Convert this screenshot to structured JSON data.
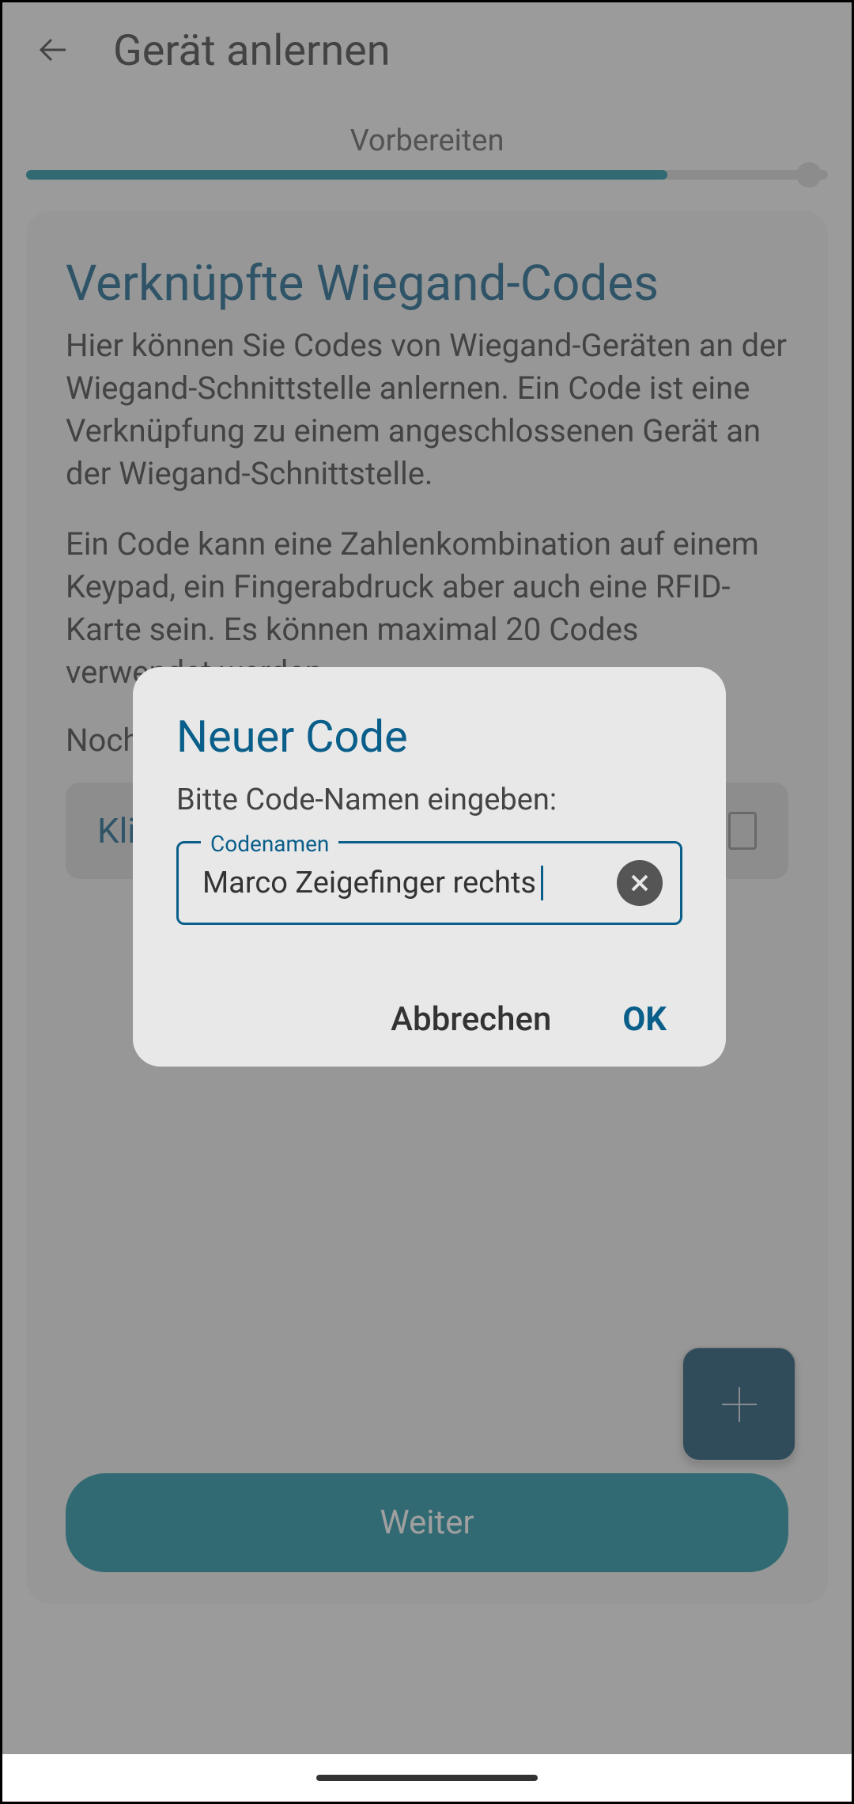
{
  "header": {
    "title": "Gerät anlernen"
  },
  "progress": {
    "step_label": "Vorbereiten",
    "percent": 80
  },
  "card": {
    "title": "Verknüpfte Wiegand-Codes",
    "paragraph1": "Hier können Sie Codes von Wiegand-Geräten an der Wiegand-Schnittstelle anlernen. Ein Code ist eine Verknüpfung zu einem angeschlossenen Gerät an der Wiegand-Schnittstelle.",
    "paragraph2": "Ein Code kann eine Zahlenkombination auf einem Keypad, ein Fingerabdruck aber auch eine RFID-Karte sein. Es können maximal 20 Codes verwendet werden.",
    "empty_state": "Noch keine Wiegand-Codes vergeben",
    "existing_item_label": "Kling…"
  },
  "footer": {
    "continue_label": "Weiter"
  },
  "dialog": {
    "title": "Neuer Code",
    "subtitle": "Bitte Code-Namen eingeben:",
    "field_label": "Codenamen",
    "field_value": "Marco Zeigefinger rechts",
    "cancel_label": "Abbrechen",
    "ok_label": "OK"
  },
  "colors": {
    "accent": "#0c8a9e",
    "brand_dark": "#0a5f8a",
    "fab": "#0a4766"
  }
}
